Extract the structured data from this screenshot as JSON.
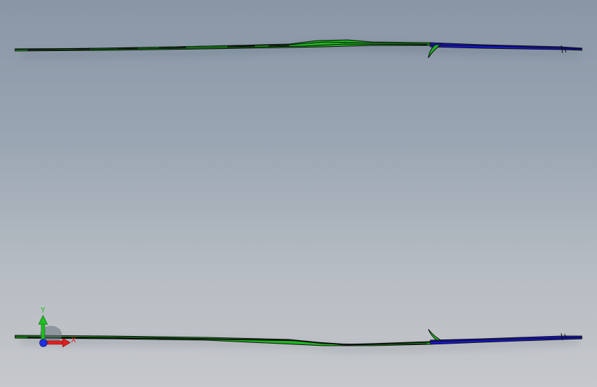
{
  "viewport": {
    "background_top": "#8896a6",
    "background_bottom": "#c6c8cb"
  },
  "model": {
    "green_color": "#21b521",
    "blue_color": "#1818d0",
    "edge_color": "#0a0a0a"
  },
  "triad": {
    "x_label": "X",
    "y_label": "Y",
    "x_color": "#e02020",
    "y_color": "#20c020",
    "z_color": "#2030e0"
  }
}
